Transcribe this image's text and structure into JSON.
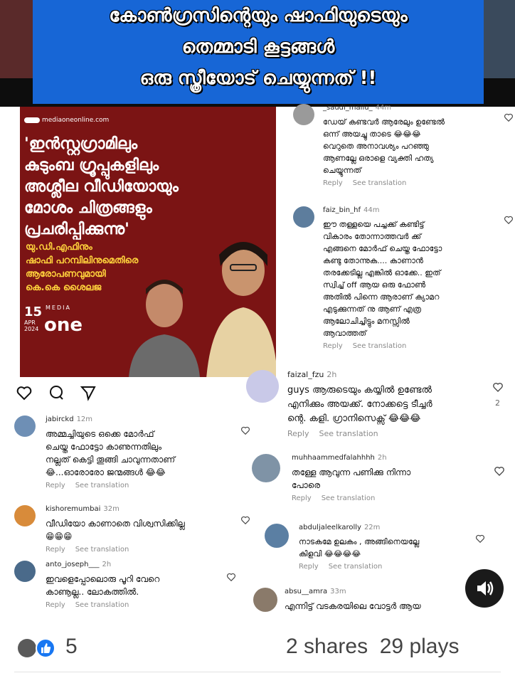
{
  "banner": {
    "line1": "കോൺഗ്രസിന്റെയും ഷാഫിയുടെയും",
    "line2": "തെമ്മാടി കൂട്ടങ്ങൾ",
    "line3": "ഒരു സ്ത്രീയോട് ചെയ്യുന്നത് !!"
  },
  "news": {
    "brand": "mediaoneonline.com",
    "headline": "'ഇൻസ്റ്റഗ്രാമിലും\nകുടുംബ ഗ്രൂപ്പുകളിലും\nഅശ്ലീല വീഡിയോയും\nമോശം ചിത്രങ്ങളും\nപ്രചരിപ്പിക്കുന്നു'",
    "sub": "യു.ഡി.എഫിനും\nഷാഫി പറമ്പിലിനുമെതിരെ\nആരോപണവുമായി\nകെ.കെ ശൈലജ",
    "date_day": "15",
    "date_month": "APR",
    "date_year": "2024",
    "media_label": "MEDIA",
    "one_label": "one"
  },
  "left_comments": [
    {
      "user": "jabirckd",
      "time": "12m",
      "text": "അമ്മച്ചിയുടെ ഒക്കെ മോർഫ്\nചെയ്ത ഫോട്ടോ കാണുന്നതിലും\nനല്ലത് കെട്ടി തൂങ്ങി ചാവുന്നതാണ്\n😂...ഓരോരോ ജന്മങ്ങൾ 😂😂",
      "reply": "Reply",
      "translate": "See translation"
    },
    {
      "user": "kishoremumbai",
      "time": "32m",
      "text": "വീഡിയോ കാണാതെ വിശ്വസിക്കില്ല\n😁😁😁",
      "reply": "Reply",
      "translate": "See translation"
    },
    {
      "user": "anto_joseph___",
      "time": "2h",
      "text": "ഇവളെപ്പോലൊരു പൂറി വേറെ\nകാണൂല്ല.. ലോകത്തിൽ.",
      "reply": "Reply",
      "translate": "See translation"
    }
  ],
  "right_comments": [
    {
      "user": "_saudi_mallu_",
      "time": "44m",
      "text": "ഡേയ് കണ്ടവർ ആരേലും ഉണ്ടേൽ\nഒന്ന് അയച്ചു താടെ 😂😂😂\nവെറുതെ അനാവശ്യം പറഞ്ഞു\nആണല്ലേ ഒരാളെ വ്യക്തി ഹത്യ\nചെയ്യുന്നത്",
      "reply": "Reply",
      "translate": "See translation"
    },
    {
      "user": "faiz_bin_hf",
      "time": "44m",
      "text": "ഈ തള്ളയെ പച്ചക്ക് കണ്ടിട്ട്\nവികാരം തോന്നാത്തവർ ക്ക്\nഎങ്ങനെ മോർഫ് ചെയ്ത ഫോട്ടോ\nകണ്ടു തോന്നുക.... കാണാൻ\nതരക്കേടില്ല എങ്കിൽ ഓക്കേ.. ഇത്\nസ്വിച്ച് off ആയ ഒരു ഫോൺ\nഅതിൽ പിന്നെ ആരാണ് ക്യാമറ\nഎടുക്കുന്നത് നു ആണ് എത്ര\nആലോചിച്ചിട്ടും മനസ്സിൽ\nആവാത്തത്",
      "reply": "Reply",
      "translate": "See translation"
    },
    {
      "user": "faizal_fzu",
      "time": "2h",
      "text": "guys ആരുടെയും കയ്യിൽ ഉണ്ടേൽ\nഎനിക്കും അയക്ക്. നോക്കട്ടെ ടീച്ചർ\nന്റെ. കളി. ഗ്രാനിസെക്സ് 😂😂😂",
      "reply": "Reply",
      "translate": "See translation",
      "likes": "2"
    },
    {
      "user": "muhhaammedfalahhhh",
      "time": "2h",
      "text": "തള്ളേ ആവുന്ന പണിക്കു നിന്നാ\nപോരെ",
      "reply": "Reply",
      "translate": "See translation"
    },
    {
      "user": "abduljaleelkarolly",
      "time": "22m",
      "text": "നാടകമേ ഉലകം , അങ്ങിനെയല്ലേ\nകിളവി 😂😂😂😂",
      "reply": "Reply",
      "translate": "See translation"
    },
    {
      "user": "absu__amra",
      "time": "33m",
      "text": "എന്നിട്ട് വടകരയിലെ വോട്ടർ ആയ",
      "reply": "",
      "translate": ""
    }
  ],
  "footer": {
    "reaction_count": "5",
    "shares": "2 shares",
    "plays": "29 plays"
  },
  "colors": {
    "banner_blue": "#1766d6",
    "news_maroon": "#7b1414",
    "news_yellow": "#ffd23c",
    "like_blue": "#1877f2"
  },
  "icons": [
    "heart-icon",
    "comment-icon",
    "send-icon",
    "like-reaction-icon",
    "volume-icon"
  ]
}
